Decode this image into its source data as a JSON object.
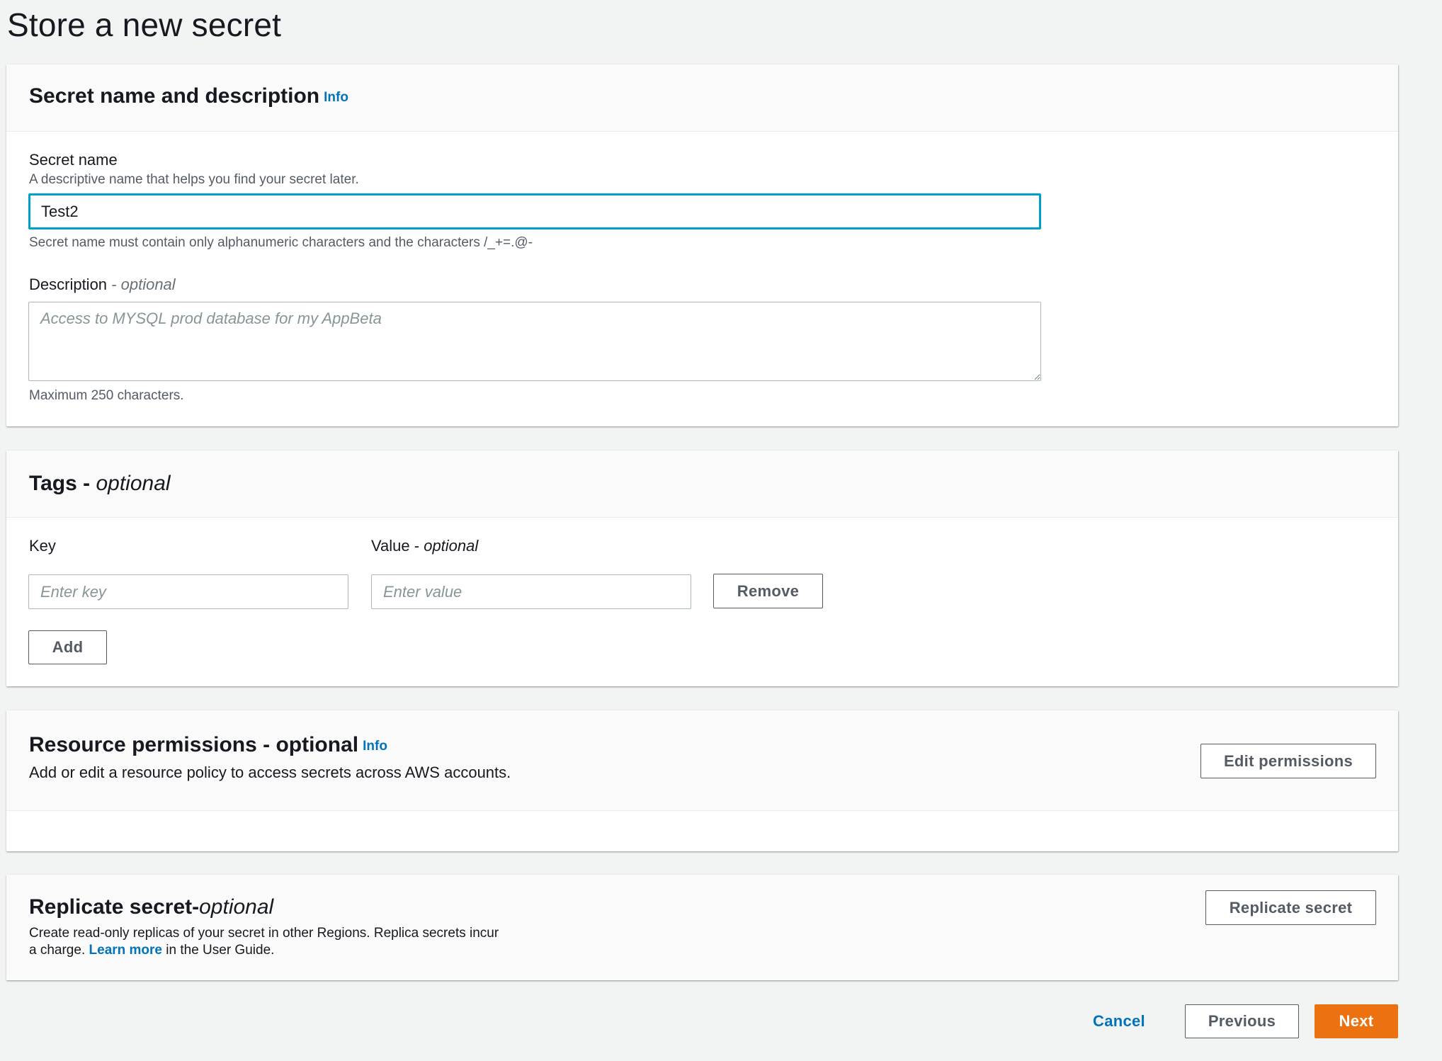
{
  "page": {
    "title": "Store a new secret"
  },
  "colors": {
    "primary": "#ec7211",
    "link": "#0073bb",
    "focus": "#00a1c9",
    "background": "#f2f3f3"
  },
  "secret_section": {
    "title": "Secret name and description",
    "info": "Info",
    "name_label": "Secret name",
    "name_description": "A descriptive name that helps you find your secret later.",
    "name_value": "Test2",
    "name_constraint": "Secret name must contain only alphanumeric characters and the characters /_+=.@-",
    "description_label": "Description",
    "description_optional": "- optional",
    "description_placeholder": "Access to MYSQL prod database for my AppBeta",
    "description_constraint": "Maximum 250 characters."
  },
  "tags_section": {
    "title": "Tags -",
    "title_optional": "optional",
    "key_label": "Key",
    "value_label": "Value -",
    "value_optional": "optional",
    "key_placeholder": "Enter key",
    "value_placeholder": "Enter value",
    "remove_label": "Remove",
    "add_label": "Add"
  },
  "permissions_section": {
    "title": "Resource permissions - optional",
    "info": "Info",
    "description": "Add or edit a resource policy to access secrets across AWS accounts.",
    "button_label": "Edit permissions"
  },
  "replicate_section": {
    "title": "Replicate secret-",
    "title_optional": "optional",
    "description_line1": "Create read-only replicas of your secret in other Regions. Replica secrets incur",
    "description_prefix": "a charge.",
    "learn_more": "Learn more",
    "description_suffix": "in the User Guide.",
    "button_label": "Replicate secret"
  },
  "footer": {
    "cancel_label": "Cancel",
    "previous_label": "Previous",
    "next_label": "Next"
  }
}
